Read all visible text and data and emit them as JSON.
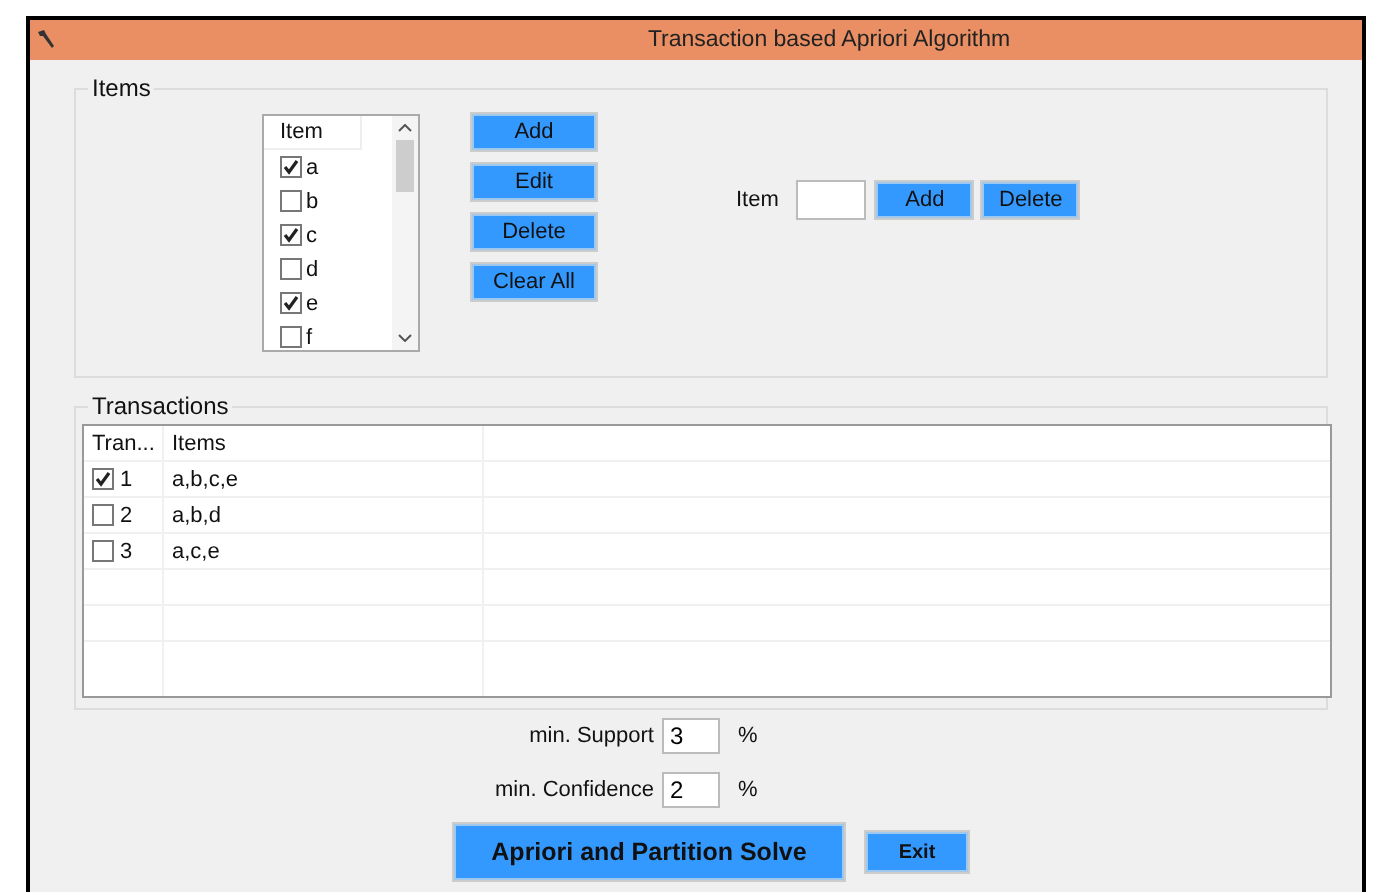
{
  "window": {
    "title": "Transaction based Apriori Algorithm"
  },
  "items_group": {
    "title": "Items",
    "list": {
      "header": "Item",
      "items": [
        {
          "label": "a",
          "checked": true
        },
        {
          "label": "b",
          "checked": false
        },
        {
          "label": "c",
          "checked": true
        },
        {
          "label": "d",
          "checked": false
        },
        {
          "label": "e",
          "checked": true
        },
        {
          "label": "f",
          "checked": false
        }
      ]
    },
    "buttons": [
      "Add",
      "Edit",
      "Delete",
      "Clear All"
    ],
    "item_label": "Item",
    "item_buttons": [
      "Add",
      "Delete"
    ]
  },
  "transactions_group": {
    "title": "Transactions",
    "columns": [
      "Tran...",
      "Items"
    ],
    "rows": [
      {
        "id": "1",
        "items": "a,b,c,e",
        "checked": true
      },
      {
        "id": "2",
        "items": "a,b,d",
        "checked": false
      },
      {
        "id": "3",
        "items": "a,c,e",
        "checked": false
      }
    ]
  },
  "min_support": {
    "label": "min. Support",
    "value": "3",
    "unit": "%"
  },
  "min_confidence": {
    "label": "min. Confidence",
    "value": "2",
    "unit": "%"
  },
  "solve_button": "Apriori and Partition  Solve",
  "exit_button": "Exit"
}
